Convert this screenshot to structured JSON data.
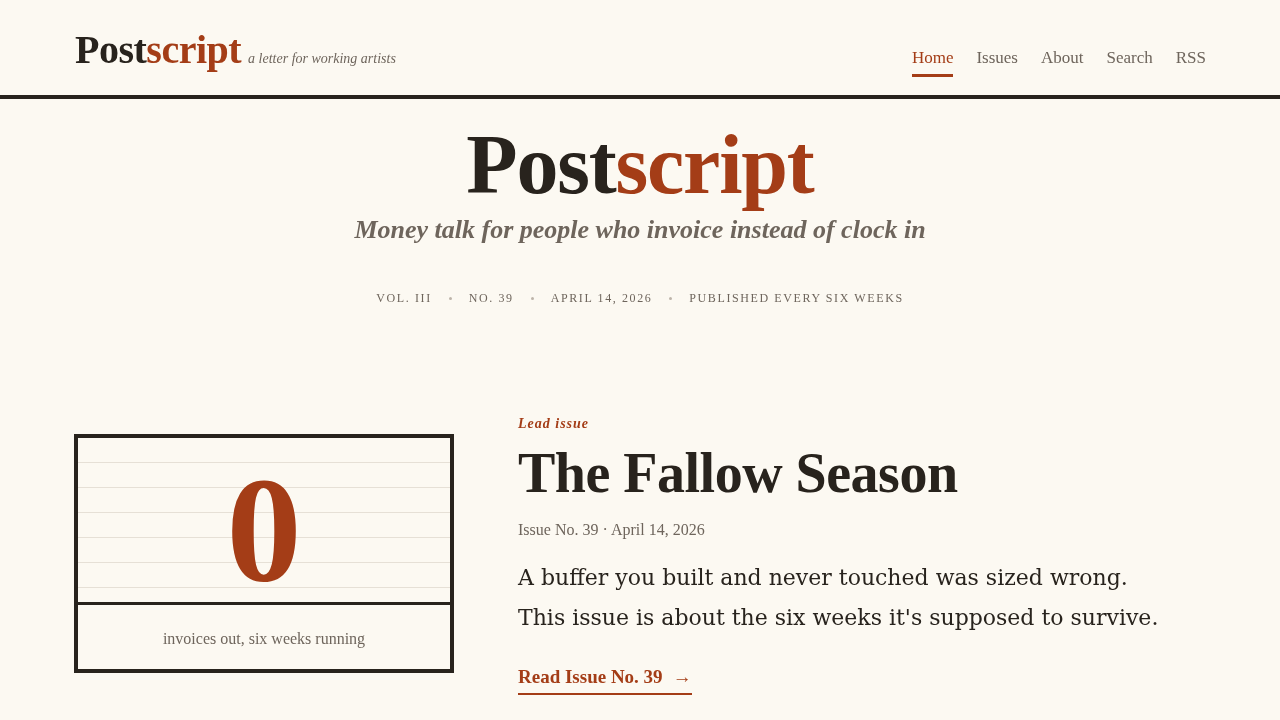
{
  "header": {
    "logo": {
      "lead": "Post",
      "accent": "script"
    },
    "tagline": "a letter for working artists",
    "nav": [
      {
        "label": "Home",
        "selected": true
      },
      {
        "label": "Issues",
        "selected": false
      },
      {
        "label": "About",
        "selected": false
      },
      {
        "label": "Search",
        "selected": false
      },
      {
        "label": "RSS",
        "selected": false
      }
    ]
  },
  "masthead": {
    "title": {
      "lead": "Post",
      "accent": "script"
    },
    "subtitle": "Money talk for people who invoice instead of clock in",
    "meta": [
      "VOL. III",
      "NO. 39",
      "APRIL 14, 2026",
      "PUBLISHED EVERY SIX WEEKS"
    ]
  },
  "lead_issue": {
    "figure": {
      "value": "0",
      "caption": "invoices out, six weeks running"
    },
    "kicker": "Lead issue",
    "title": "The Fallow Season",
    "meta": "Issue No. 39 · April 14, 2026",
    "deck": "A buffer you built and never touched was sized wrong. This issue is about the six weeks it's supposed to survive.",
    "link": {
      "label": "Read Issue No. 39",
      "arrow": "→"
    }
  }
}
